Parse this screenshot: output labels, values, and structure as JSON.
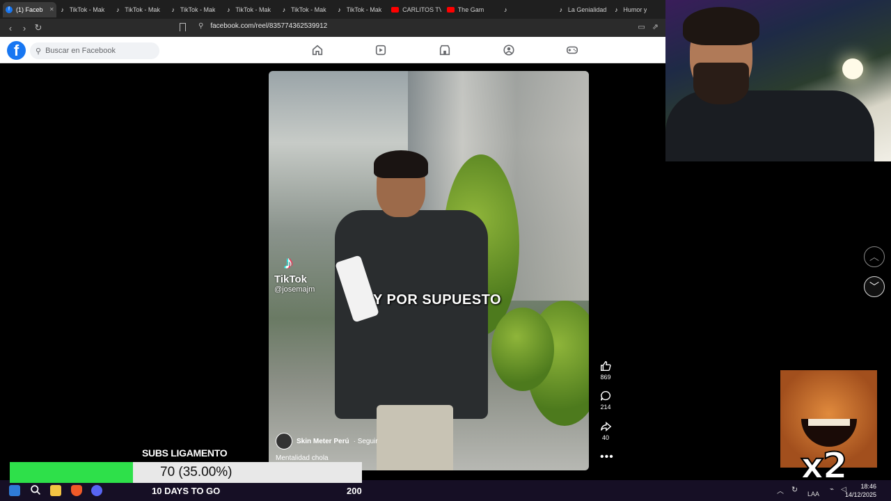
{
  "browser": {
    "tabs": [
      {
        "label": "(1) Faceb",
        "icon": "facebook-icon",
        "active": true
      },
      {
        "label": "TikTok - Mak",
        "icon": "tiktok-icon"
      },
      {
        "label": "TikTok - Mak",
        "icon": "tiktok-icon"
      },
      {
        "label": "TikTok - Mak",
        "icon": "tiktok-icon"
      },
      {
        "label": "TikTok - Mak",
        "icon": "tiktok-icon"
      },
      {
        "label": "TikTok - Mak",
        "icon": "tiktok-icon"
      },
      {
        "label": "TikTok - Mak",
        "icon": "tiktok-icon"
      },
      {
        "label": "CARLITOS TV",
        "icon": "youtube-icon"
      },
      {
        "label": "The Gam",
        "icon": "youtube-icon"
      },
      {
        "label": "   ",
        "icon": "tiktok-icon"
      },
      {
        "label": "La Genialidad",
        "icon": "tiktok-icon"
      },
      {
        "label": "Humor y",
        "icon": "tiktok-icon"
      }
    ],
    "url": "facebook.com/reel/835774362539912"
  },
  "facebook": {
    "logo_letter": "f",
    "search_placeholder": "Buscar en Facebook",
    "nav_icons": [
      "home-icon",
      "reels-icon",
      "marketplace-icon",
      "groups-icon",
      "gaming-icon"
    ]
  },
  "reel": {
    "overlay_text": "Y POR SUPUESTO",
    "watermark_brand": "TikTok",
    "watermark_handle": "@josemajm",
    "author": "Skin Meter Perú",
    "follow": "· Seguir",
    "caption": "Mentalidad chola",
    "likes": "869",
    "comments": "214",
    "shares": "40",
    "more": "•••"
  },
  "stream_overlay": {
    "goal_title": "SUBS LIGAMENTO",
    "goal_value": "70 (35.00%)",
    "goal_progress": 0.35,
    "days_left": "10 DAYS TO GO",
    "goal_target": "200",
    "meme_label": "x2"
  },
  "taskbar": {
    "language": "LAA",
    "time": "18:46",
    "date": "14/12/2025"
  },
  "colors": {
    "facebook_blue": "#1877f2",
    "goal_fill": "#2ee04a"
  }
}
